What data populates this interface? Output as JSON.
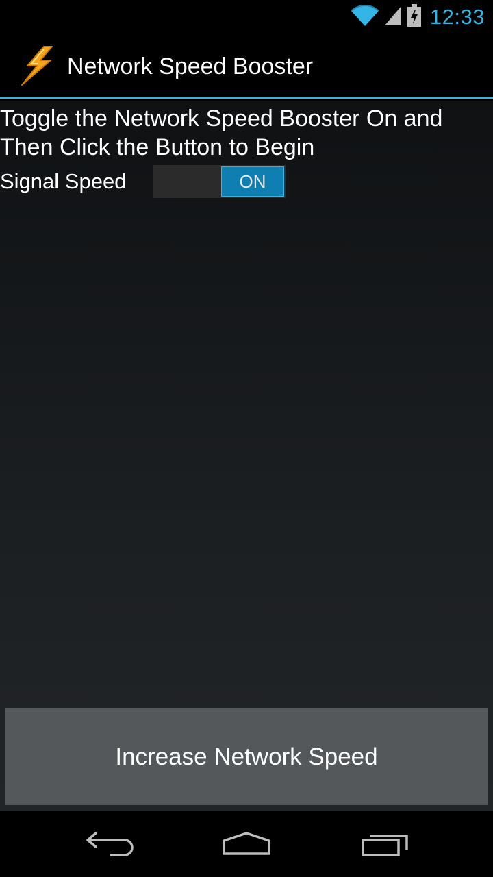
{
  "status_bar": {
    "time": "12:33",
    "icons": [
      "wifi-icon",
      "cell-signal-icon",
      "battery-charging-icon"
    ],
    "accent_color": "#33b5e5"
  },
  "action_bar": {
    "title": "Network Speed Booster",
    "icon": "lightning-bolt-icon",
    "divider_color": "#33b5e5"
  },
  "main": {
    "instruction": "Toggle the Network Speed Booster On and Then Click the Button to Begin",
    "signal_label": "Signal Speed",
    "switch": {
      "state_label": "ON",
      "checked": true,
      "thumb_color": "#0e7fb0"
    },
    "boost_button_label": "Increase Network Speed"
  },
  "nav_bar": {
    "buttons": [
      "back-icon",
      "home-icon",
      "recent-apps-icon"
    ]
  }
}
